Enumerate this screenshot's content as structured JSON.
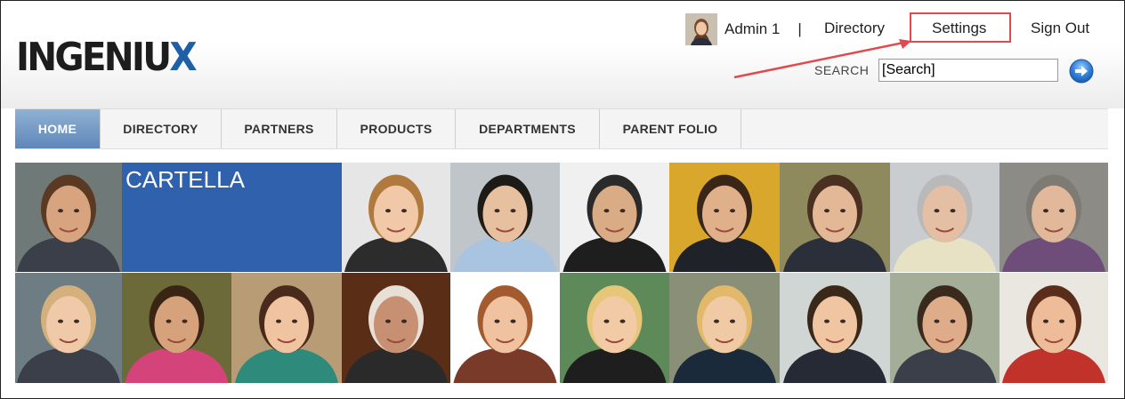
{
  "header": {
    "logo_text": "INGENIU",
    "logo_x": "X",
    "user_name": "Admin 1",
    "separator": "|",
    "links": {
      "directory": "Directory",
      "settings": "Settings",
      "signout": "Sign Out"
    },
    "search_label": "SEARCH",
    "search_value": "[Search]"
  },
  "menu": {
    "items": [
      {
        "label": "HOME",
        "active": true
      },
      {
        "label": "DIRECTORY"
      },
      {
        "label": "PARTNERS"
      },
      {
        "label": "PRODUCTS"
      },
      {
        "label": "DEPARTMENTS"
      },
      {
        "label": "PARENT FOLIO"
      }
    ]
  },
  "tiles": {
    "featured_label": "CARTELLA"
  },
  "colors": {
    "accent": "#2f61ad",
    "highlight_box": "#e2494f",
    "logo_x": "#1f5fa8"
  }
}
